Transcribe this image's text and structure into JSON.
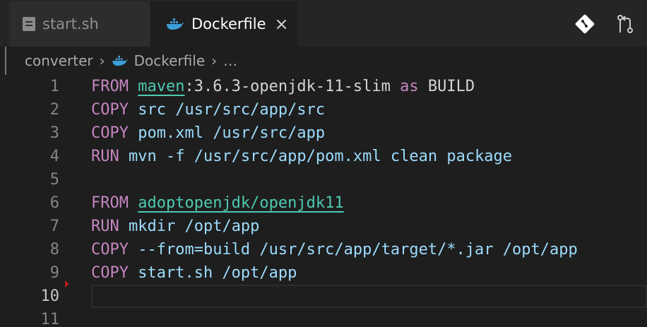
{
  "tabs": [
    {
      "label": "start.sh",
      "icon": "file-icon"
    },
    {
      "label": "Dockerfile",
      "icon": "docker-whale-icon",
      "close": "×"
    }
  ],
  "breadcrumb": {
    "folder": "converter",
    "sep": "›",
    "file": "Dockerfile",
    "more": "…"
  },
  "colors": {
    "keyword": "#c586c0",
    "argument": "#9cdcfe",
    "image": "#4ec9b0",
    "docker_blue": "#3c9fdb"
  },
  "code_lines": [
    {
      "n": "1",
      "kw": "FROM",
      "img": "maven",
      "rest": ":3.6.3-openjdk-11-slim ",
      "as": "as",
      "tail": " BUILD"
    },
    {
      "n": "2",
      "kw": "COPY",
      "args": " src /usr/src/app/src"
    },
    {
      "n": "3",
      "kw": "COPY",
      "args": " pom.xml /usr/src/app"
    },
    {
      "n": "4",
      "kw": "RUN",
      "args": " mvn -f /usr/src/app/pom.xml clean package"
    },
    {
      "n": "5"
    },
    {
      "n": "6",
      "kw": "FROM",
      "img": "adoptopenjdk/openjdk11"
    },
    {
      "n": "7",
      "kw": "RUN",
      "args": " mkdir /opt/app"
    },
    {
      "n": "8",
      "kw": "COPY",
      "args": " --from=build /usr/src/app/target/*.jar /opt/app"
    },
    {
      "n": "9",
      "kw": "COPY",
      "args": " start.sh /opt/app"
    },
    {
      "n": "10"
    },
    {
      "n": "11"
    }
  ]
}
